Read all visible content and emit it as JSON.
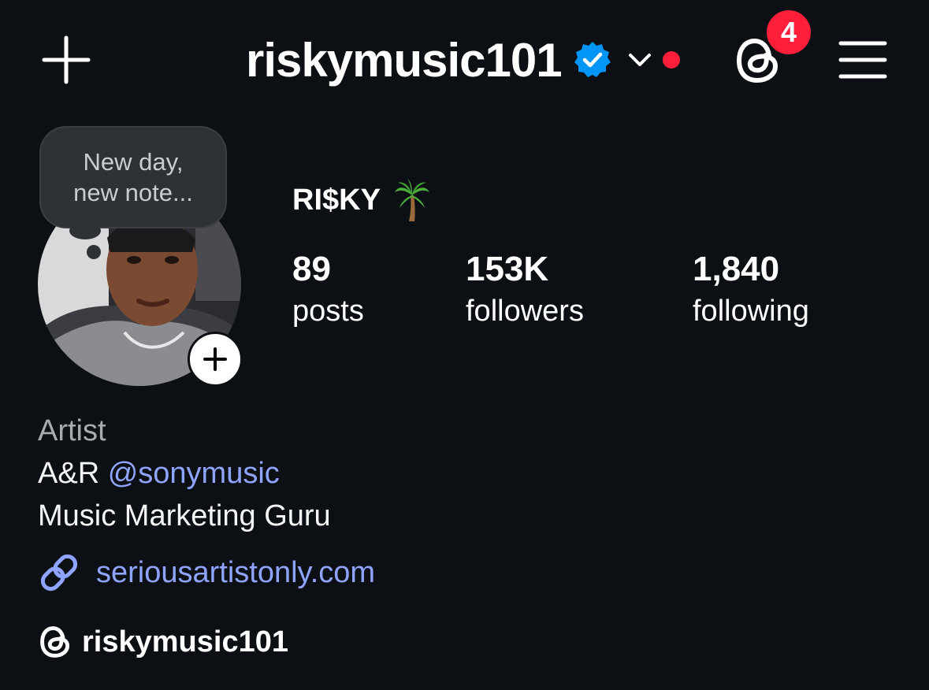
{
  "header": {
    "username": "riskymusic101",
    "threads_badge_count": "4"
  },
  "note": {
    "text_line1": "New day,",
    "text_line2": "new note..."
  },
  "profile": {
    "display_name": "RI$KY",
    "stats": [
      {
        "value": "89",
        "label": "posts"
      },
      {
        "value": "153K",
        "label": "followers"
      },
      {
        "value": "1,840",
        "label": "following"
      }
    ]
  },
  "bio": {
    "category": "Artist",
    "line1_prefix": "A&R ",
    "line1_mention": "@sonymusic",
    "line2": "Music Marketing Guru",
    "link": "seriousartistonly.com",
    "threads_handle": "riskymusic101"
  },
  "icons": {
    "add": "plus-icon",
    "verified": "verified-badge-icon",
    "dropdown": "chevron-down-icon",
    "threads": "threads-icon",
    "menu": "hamburger-menu-icon",
    "link": "link-icon",
    "palm": "palm-tree-emoji"
  },
  "colors": {
    "background": "#0c1014",
    "accent_link": "#8fa4ff",
    "verified_blue": "#0095f6",
    "notification_red": "#ff1f3a",
    "muted_text": "#a8abb0"
  }
}
